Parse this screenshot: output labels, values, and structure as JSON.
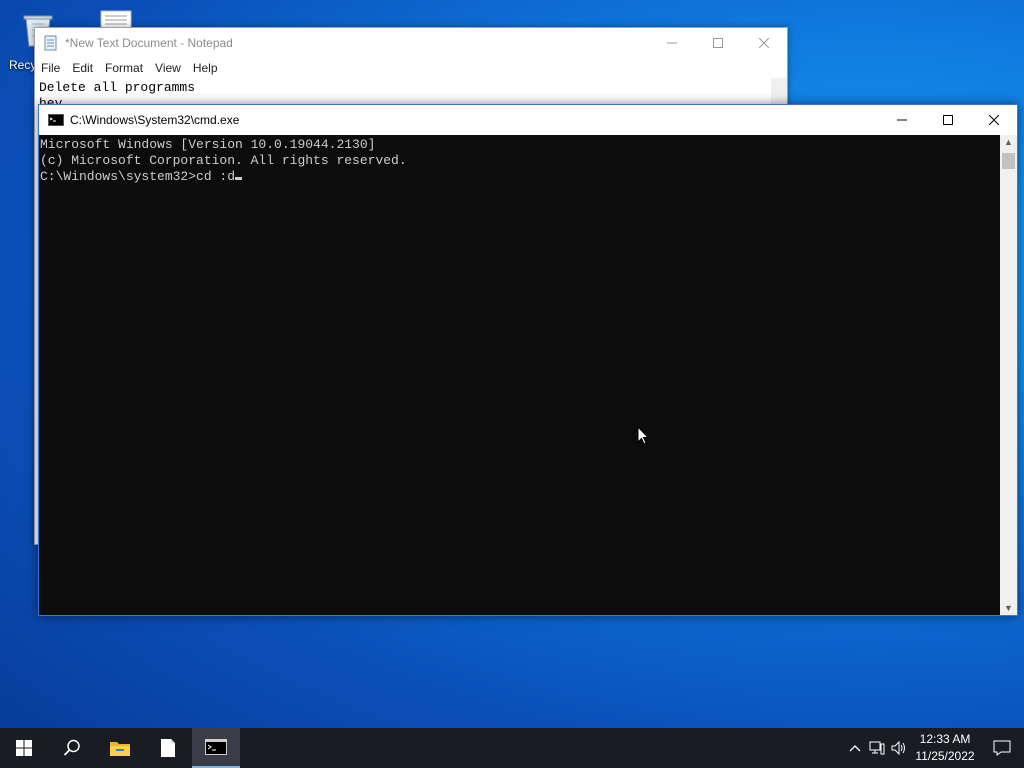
{
  "desktop": {
    "recycle_label": "Recy",
    "icons": [
      "recycle-bin-icon",
      "text-document-icon"
    ]
  },
  "notepad": {
    "title": "*New Text Document - Notepad",
    "menu": [
      "File",
      "Edit",
      "Format",
      "View",
      "Help"
    ],
    "lines": [
      "Delete all programms",
      "hey"
    ]
  },
  "cmd": {
    "title": "C:\\Windows\\System32\\cmd.exe",
    "lines": [
      "Microsoft Windows [Version 10.0.19044.2130]",
      "(c) Microsoft Corporation. All rights reserved.",
      "",
      "C:\\Windows\\system32>cd :d"
    ]
  },
  "taskbar": {
    "items": [
      "start-icon",
      "search-icon",
      "file-explorer-icon",
      "notepad-icon",
      "cmd-icon"
    ],
    "active": "cmd-icon",
    "time": "12:33 AM",
    "date": "11/25/2022"
  },
  "colors": {
    "cmd_bg": "#0c0c0c",
    "cmd_text": "#cccccc",
    "taskbar_bg": "#1a1c24",
    "accent": "#76b9ed"
  }
}
